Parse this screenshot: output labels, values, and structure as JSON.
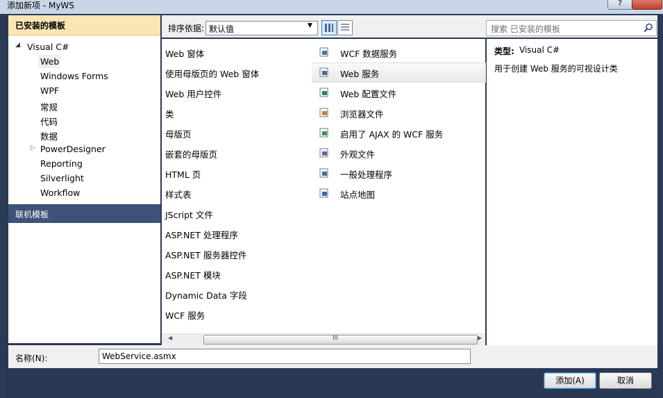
{
  "window": {
    "title": "添加新项 - MyWS",
    "help_label": "?"
  },
  "sidebar": {
    "installed_header": "已安装的模板",
    "root": {
      "expander": "◢",
      "label": "Visual C#"
    },
    "items": [
      {
        "label": "Web"
      },
      {
        "label": "Windows Forms"
      },
      {
        "label": "WPF"
      },
      {
        "label": "常规"
      },
      {
        "label": "代码"
      },
      {
        "label": "数据"
      },
      {
        "label": "PowerDesigner",
        "expander": "▷"
      },
      {
        "label": "Reporting"
      },
      {
        "label": "Silverlight"
      },
      {
        "label": "Workflow"
      }
    ],
    "online_header": "联机模板"
  },
  "toolbar": {
    "sort_label": "排序依据:",
    "sort_value": "默认值",
    "search_placeholder": "搜索 已安装的模板"
  },
  "templates_left": [
    "Web 窗体",
    "使用母版页的 Web 窗体",
    "Web 用户控件",
    "类",
    "母版页",
    "嵌套的母版页",
    "HTML 页",
    "样式表",
    "JScript 文件",
    "ASP.NET 处理程序",
    "ASP.NET 服务器控件",
    "ASP.NET 模块",
    "Dynamic Data 字段",
    "WCF 服务"
  ],
  "templates_right": [
    {
      "label": "WCF 数据服务",
      "icon": "wcf-data-service-icon"
    },
    {
      "label": "Web 服务",
      "icon": "web-service-icon"
    },
    {
      "label": "Web 配置文件",
      "icon": "web-config-icon"
    },
    {
      "label": "浏览器文件",
      "icon": "browser-file-icon"
    },
    {
      "label": "启用了 AJAX 的 WCF 服务",
      "icon": "ajax-wcf-icon"
    },
    {
      "label": "外观文件",
      "icon": "skin-file-icon"
    },
    {
      "label": "一般处理程序",
      "icon": "generic-handler-icon"
    },
    {
      "label": "站点地图",
      "icon": "sitemap-icon"
    }
  ],
  "details": {
    "type_label": "类型:",
    "type_value": "Visual C#",
    "description": "用于创建 Web 服务的可视设计类"
  },
  "bottom": {
    "name_label": "名称(N):",
    "name_value": "WebService.asmx",
    "add_label": "添加(A)",
    "cancel_label": "取消"
  },
  "scrollbar": {
    "grip": "III"
  }
}
